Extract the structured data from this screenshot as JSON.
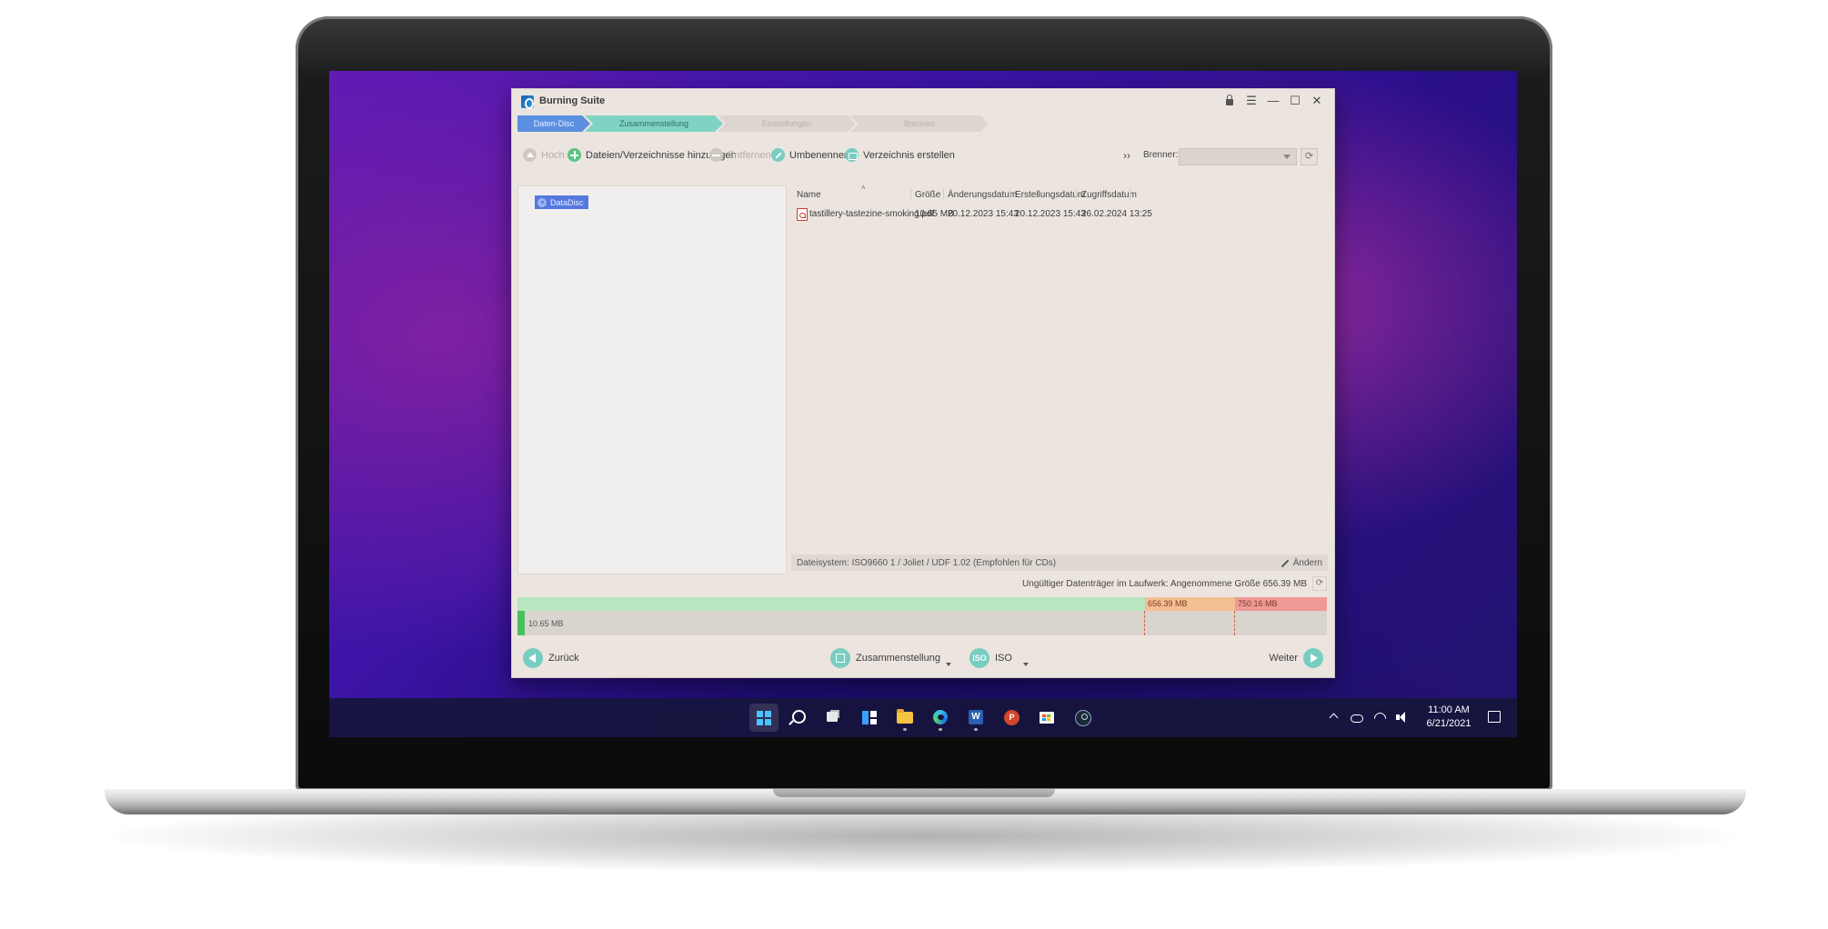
{
  "window": {
    "title": "Burning Suite"
  },
  "steps": [
    {
      "label": "Daten-Disc",
      "state": "done"
    },
    {
      "label": "Zusammenstellung",
      "state": "active"
    },
    {
      "label": "Einstellungen",
      "state": "pending"
    },
    {
      "label": "Brennen",
      "state": "pending"
    }
  ],
  "toolbar": {
    "up_label": "Hoch",
    "add_label": "Dateien/Verzeichnisse hinzufügen",
    "remove_label": "Entfernen",
    "rename_label": "Umbenennen",
    "mkdir_label": "Verzeichnis erstellen",
    "more_label": "››",
    "burner_label": "Brenner:",
    "burner_value": ""
  },
  "tree": {
    "root_label": "DataDisc"
  },
  "file_list": {
    "columns": [
      "Name",
      "Größe",
      "Änderungsdatum",
      "Erstellungsdatum",
      "Zugriffsdatum"
    ],
    "rows": [
      {
        "name": "tastillery-tastezine-smoking.pdf",
        "size": "10.65 MB",
        "modified": "20.12.2023 15:43",
        "created": "20.12.2023 15:43",
        "accessed": "26.02.2024 13:25"
      }
    ]
  },
  "filesystem": {
    "text": "Dateisystem: ISO9660 1 / Joliet / UDF 1.02 (Empfohlen für CDs)",
    "edit_label": "Ändern"
  },
  "disc_status": "Ungültiger Datenträger im Laufwerk: Angenommene Größe 656.39 MB",
  "capacity": {
    "used_label": "10.65 MB",
    "mark1_label": "656.39 MB",
    "mark2_label": "750.16 MB",
    "colors": {
      "ok": "#b7e6c0",
      "warn": "#f4bf93",
      "over": "#ef9a97",
      "used": "#47c15e"
    }
  },
  "bottom_nav": {
    "back_label": "Zurück",
    "compilation_label": "Zusammenstellung",
    "iso_badge": "ISO",
    "iso_label": "ISO",
    "next_label": "Weiter"
  },
  "taskbar": {
    "icons": [
      "start-icon",
      "search-icon",
      "task-view-icon",
      "widgets-icon",
      "file-explorer-icon",
      "edge-icon",
      "word-icon",
      "powerpoint-icon",
      "store-icon",
      "steam-icon"
    ],
    "word_letter": "W",
    "ppt_letter": "P",
    "time": "11:00 AM",
    "date": "6/21/2021"
  }
}
